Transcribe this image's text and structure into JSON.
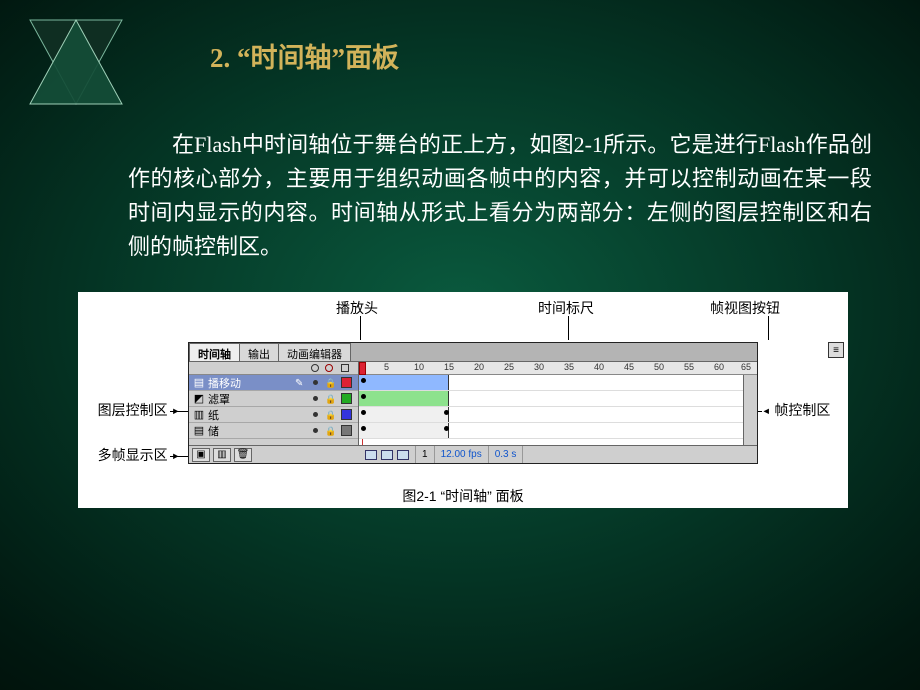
{
  "title": "2. “时间轴”面板",
  "para": "在Flash中时间轴位于舞台的正上方，如图2-1所示。它是进行Flash作品创作的核心部分，主要用于组织动画各帧中的内容，并可以控制动画在某一段时间内显示的内容。时间轴从形式上看分为两部分：左侧的图层控制区和右侧的帧控制区。",
  "ann": {
    "playhead": "播放头",
    "ruler": "时间标尺",
    "fvbtn": "帧视图按钮",
    "layer_area": "图层控制区",
    "onion": "多帧显示区",
    "frame_area": "帧控制区"
  },
  "tabs": {
    "t1": "时间轴",
    "t2": "输出",
    "t3": "动画编辑器"
  },
  "layers": [
    {
      "name": "播移动",
      "color": "#d23",
      "sel": true
    },
    {
      "name": "滤罩",
      "color": "#2a2",
      "sel": false
    },
    {
      "name": "纸",
      "color": "#33d",
      "sel": false
    },
    {
      "name": "储",
      "color": "#777",
      "sel": false
    }
  ],
  "ruler_ticks": [
    "5",
    "10",
    "15",
    "20",
    "25",
    "30",
    "35",
    "40",
    "45",
    "50",
    "55",
    "60",
    "65"
  ],
  "status": {
    "frame": "1",
    "fps": "12.00 fps",
    "time": "0.3 s"
  },
  "caption": "图2-1 “时间轴” 面板"
}
